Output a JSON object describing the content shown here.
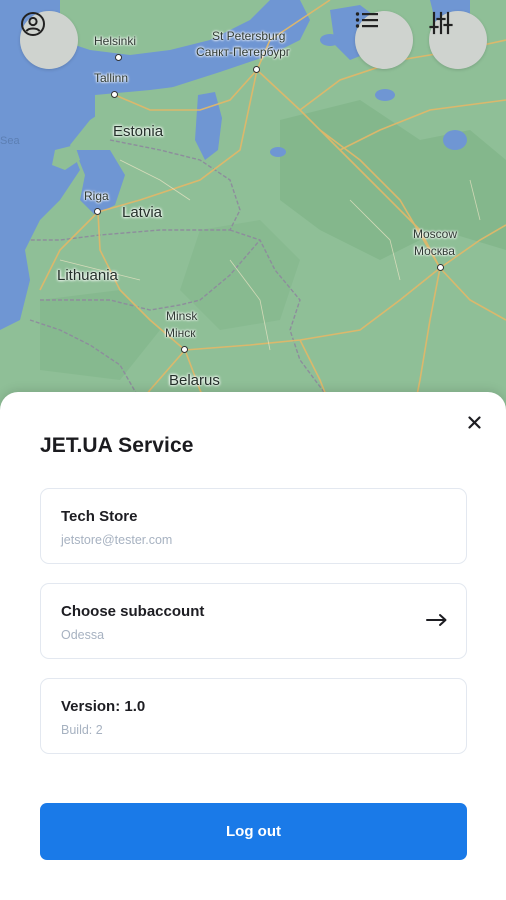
{
  "map": {
    "cities": [
      {
        "id": "helsinki",
        "name": "Helsinki"
      },
      {
        "id": "st-petersburg",
        "name": "St Petersburg"
      },
      {
        "id": "st-petersburg-ru",
        "name": "Санкт-Петербург"
      },
      {
        "id": "tallinn",
        "name": "Tallinn"
      },
      {
        "id": "riga",
        "name": "Riga"
      },
      {
        "id": "moscow",
        "name": "Moscow"
      },
      {
        "id": "moscow-ru",
        "name": "Москва"
      },
      {
        "id": "minsk",
        "name": "Minsk"
      },
      {
        "id": "minsk-ru",
        "name": "Мінск"
      }
    ],
    "countries": {
      "estonia": "Estonia",
      "latvia": "Latvia",
      "lithuania": "Lithuania",
      "belarus": "Belarus"
    },
    "sea": "Sea",
    "colors": {
      "land": "#8fbf97",
      "water": "#6f96d3",
      "roads": "#e0b86a",
      "borders": "#8d8d9c"
    }
  },
  "controls": {
    "profile_icon": "user-circle-icon",
    "list_icon": "list-icon",
    "filters_icon": "sliders-icon"
  },
  "sheet": {
    "close_icon": "close-icon",
    "title": "JET.UA Service",
    "account": {
      "name": "Tech Store",
      "email": "jetstore@tester.com"
    },
    "subaccount": {
      "label": "Choose subaccount",
      "value": "Odessa",
      "arrow_icon": "arrow-right-icon"
    },
    "version": {
      "label": "Version: 1.0",
      "build": "Build: 2"
    },
    "logout_label": "Log out",
    "colors": {
      "primary": "#1a7ae8",
      "card_border": "#e3e8f0",
      "muted_text": "#a7b2c1"
    }
  }
}
